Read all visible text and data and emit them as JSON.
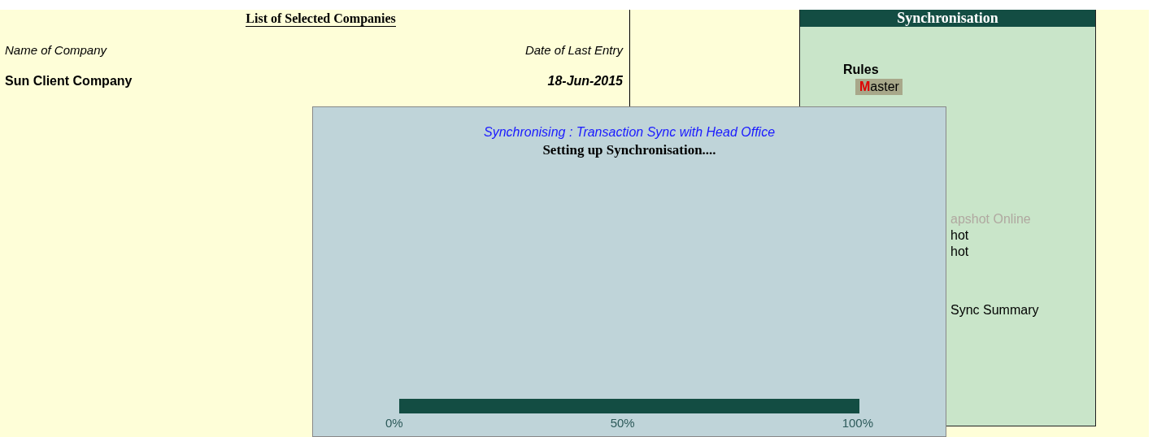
{
  "report": {
    "title": "List of Selected Companies",
    "columns": [
      "Name of Company",
      "Date of Last Entry"
    ],
    "rows": [
      {
        "name": "Sun Client Company",
        "date": "18-Jun-2015"
      }
    ]
  },
  "panel": {
    "title": "Synchronisation",
    "heading": "Rules",
    "groups": [
      [
        {
          "label": "**M**aster",
          "selected": true,
          "disabled": false
        }
      ],
      [
        {
          "label": "apshot Online",
          "selected": false,
          "disabled": true
        },
        {
          "label": "hot",
          "selected": false,
          "disabled": false
        },
        {
          "label": "hot",
          "selected": false,
          "disabled": false
        }
      ],
      [
        {
          "label": "Sync Summary",
          "selected": false,
          "disabled": false
        }
      ]
    ]
  },
  "dialog": {
    "caption": "Synchronising : Transaction Sync with Head Office",
    "status": "Setting up Synchronisation....",
    "progress": {
      "level": 1,
      "ticks": [
        "0%",
        "50%",
        "100%"
      ]
    }
  }
}
